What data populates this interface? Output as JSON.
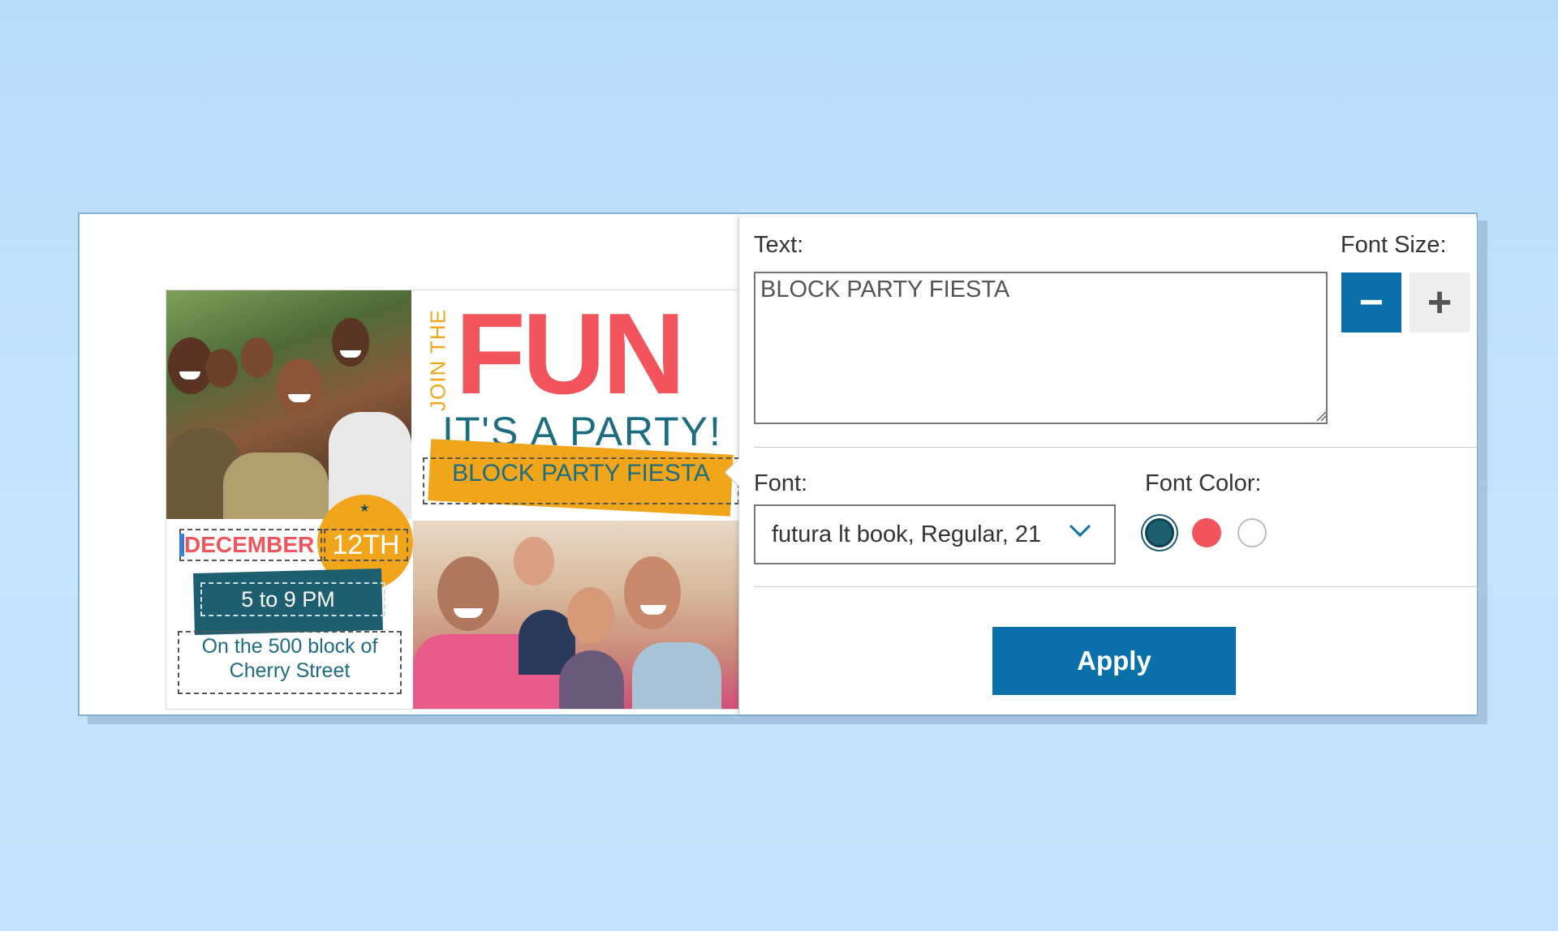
{
  "card": {
    "headline_small": "JOIN THE",
    "headline_big": "FUN",
    "subheadline": "IT'S A PARTY!",
    "event_name": "BLOCK PARTY FIESTA",
    "month": "DECEMBER",
    "day": "12TH",
    "time": "5 to 9 PM",
    "address_line1": "On the 500 block of",
    "address_line2": "Cherry Street"
  },
  "panel": {
    "text_label": "Text:",
    "text_value": "BLOCK PARTY FIESTA",
    "font_size_label": "Font Size:",
    "decrease_label": "−",
    "increase_label": "+",
    "font_label": "Font:",
    "font_value": "futura lt book, Regular, 21",
    "font_color_label": "Font Color:",
    "apply_label": "Apply"
  },
  "colors": {
    "accent_blue": "#0a70aa",
    "teal": "#1d5f70",
    "coral": "#f1545a",
    "orange": "#f0a51a",
    "white": "#ffffff"
  },
  "icons": {
    "minus": "minus-icon",
    "plus": "plus-icon",
    "dropdown": "chevron-down-icon",
    "resize": "resize-grip-icon"
  }
}
